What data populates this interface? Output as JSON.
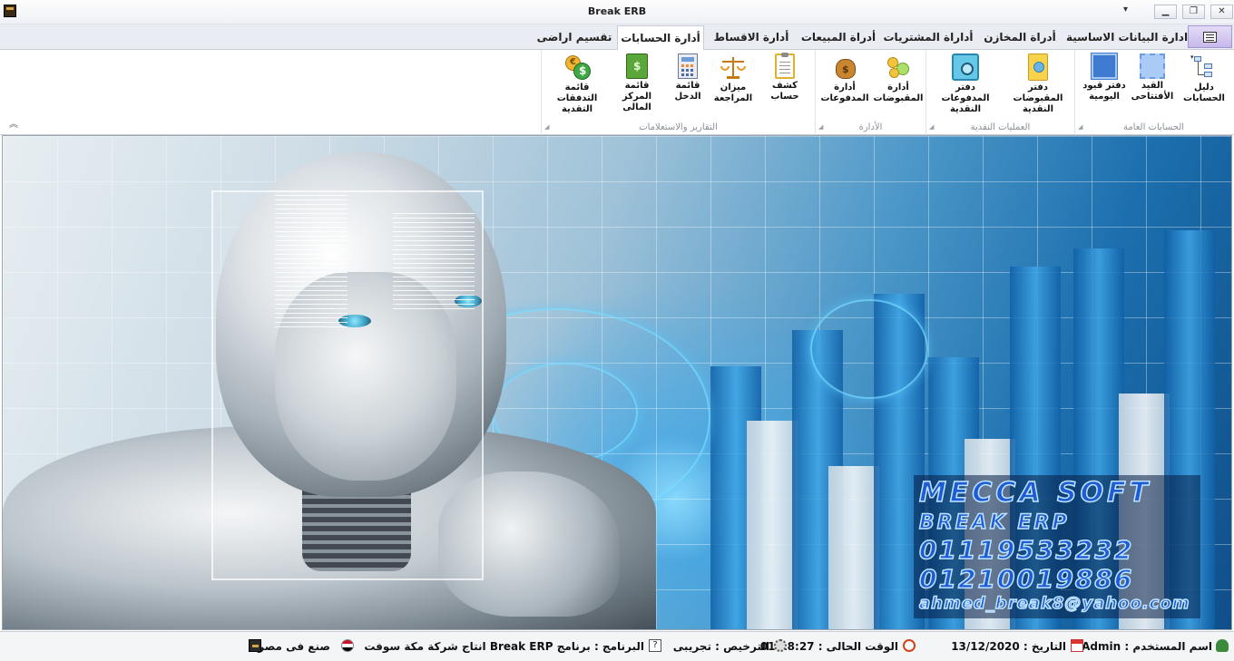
{
  "window": {
    "title": "Break ERB",
    "buttons": {
      "minimize": "▁",
      "restore": "❐",
      "close": "✕"
    },
    "dropdown_glyph": "▾"
  },
  "tabs": [
    {
      "id": "basic-data",
      "label": "ادارة البيانات الاساسية",
      "active": false
    },
    {
      "id": "stores",
      "label": "أدراة المخازن",
      "active": false
    },
    {
      "id": "purchases",
      "label": "أداراة المشتريات",
      "active": false
    },
    {
      "id": "sales",
      "label": "أدراة المبيعات",
      "active": false
    },
    {
      "id": "installments",
      "label": "أدارة الاقساط",
      "active": false
    },
    {
      "id": "accounts",
      "label": "أدارة الحسابات",
      "active": true
    },
    {
      "id": "land",
      "label": "تقسيم اراضى",
      "active": false
    }
  ],
  "ribbon": {
    "groups": {
      "general_accounts": {
        "label": "الحسابات العامة",
        "buttons": {
          "chart_of_accounts": "دليل الحسابات",
          "opening_entry": "القيد\nالأفتتاحى",
          "daily_journal": "دفتر قيود\nاليومية"
        }
      },
      "cash_operations": {
        "label": "العمليات النقدية",
        "buttons": {
          "cash_receipts_book": "دفتر المقبوضات\nالنقدية",
          "cash_payments_book": "دفتر المدفوعات\nالنقدية"
        }
      },
      "management": {
        "label": "الأدارة",
        "buttons": {
          "receipts_mgmt": "أدارة\nالمقبوضات",
          "payments_mgmt": "أدارة\nالمدفوعات"
        }
      },
      "reports": {
        "label": "التقارير والاستعلامات",
        "buttons": {
          "account_statement": "كشف حساب",
          "trial_balance": "ميزان\nالمراجعة",
          "income_statement": "قائمة\nالدخل",
          "financial_position": "قائمة المركز\nالمالى",
          "cash_flows": "قائمة التدفقات\nالتقدية"
        }
      }
    },
    "collapse_glyph": "︽"
  },
  "banner": {
    "logo_lines": [
      "MECCA SOFT",
      "BREAK ERP",
      "01119533232",
      "01210019886",
      "ahmed_break8@yahoo.com"
    ]
  },
  "statusbar": {
    "user": "اسم المستخدم : Admin",
    "date": "التاريخ : 13/12/2020",
    "time": "الوقت الحالى : 01:18:27",
    "license": "الترخيص : تجريبى",
    "program": "البرنامج : برنامج Break ERP  انتاج شركة مكة سوفت",
    "made_in": "صنع فى مصر"
  },
  "colors": {
    "app_menu": "#c7b8ec",
    "banner_blue": "#1c6fae",
    "logo_text": "#1e5bd6"
  }
}
